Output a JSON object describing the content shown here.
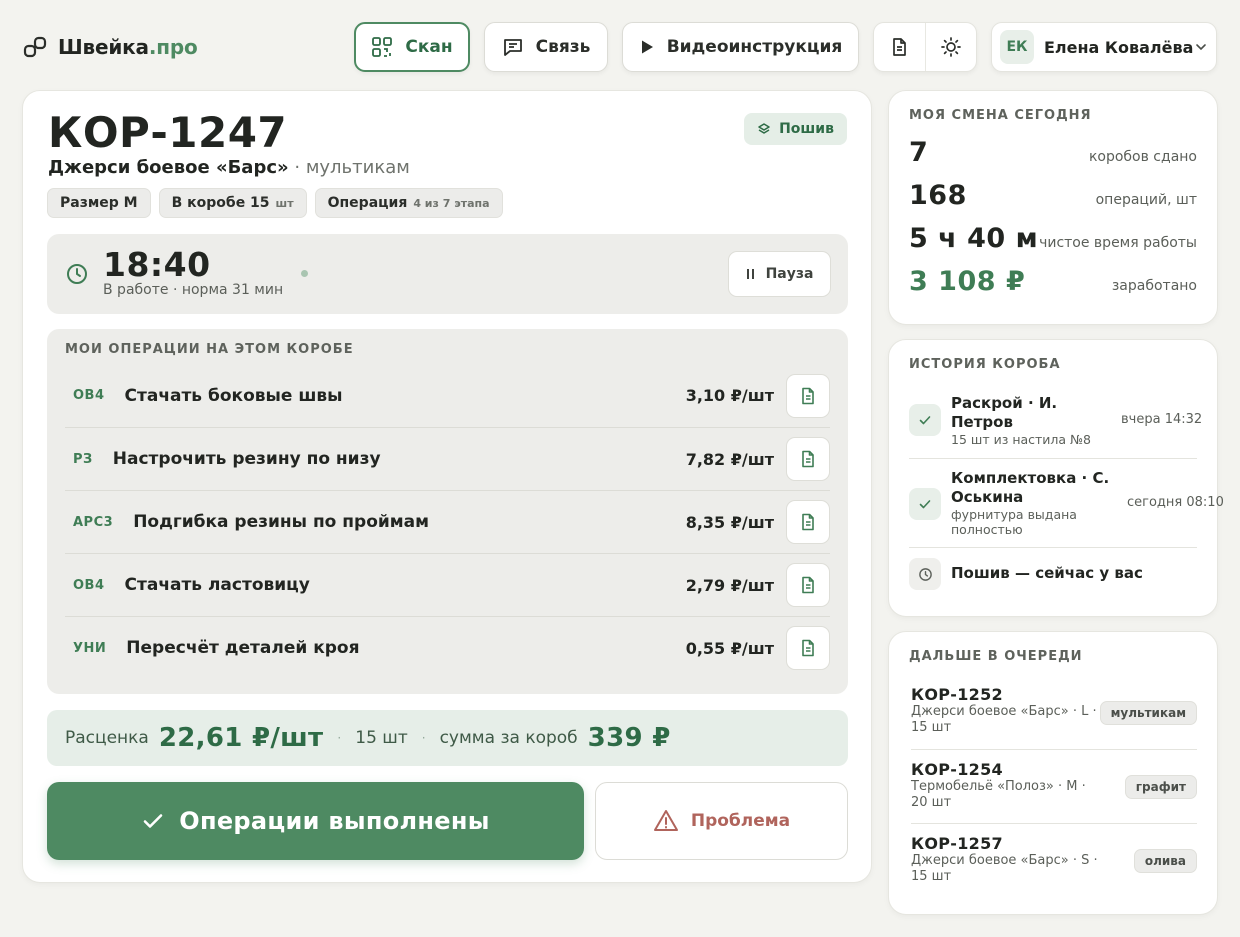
{
  "app": {
    "name_main": "Швейка",
    "name_accent": ".про"
  },
  "header": {
    "scan_label": "Скан",
    "chat_label": "Связь",
    "video_label": "Видеоинструкция",
    "user_initials": "ЕК",
    "user_name": "Елена Ковалёва"
  },
  "box": {
    "id": "КОР-1247",
    "stage": "Пошив",
    "product": "Джерси боевое «Барс»",
    "separator": " · ",
    "color": "мультикам",
    "chips": {
      "size": "Размер М",
      "qty_label": "В коробе 15",
      "qty_unit": "шт",
      "op_label": "Операция",
      "op_progress": "4 из 7 этапа"
    }
  },
  "timer": {
    "time": "18:40",
    "sub": "В работе · норма 31 мин",
    "pause_label": "Пауза"
  },
  "operations": {
    "title": "МОИ ОПЕРАЦИИ НА ЭТОМ КОРОБЕ",
    "items": [
      {
        "code": "ОВ4",
        "name": "Стачать боковые швы",
        "price": "3,10 ₽/шт"
      },
      {
        "code": "РЗ",
        "name": "Настрочить резину по низу",
        "price": "7,82 ₽/шт"
      },
      {
        "code": "АРС3",
        "name": "Подгибка резины по проймам",
        "price": "8,35 ₽/шт"
      },
      {
        "code": "ОВ4",
        "name": "Стачать ластовицу",
        "price": "2,79 ₽/шт"
      },
      {
        "code": "УНИ",
        "name": "Пересчёт деталей кроя",
        "price": "0,55 ₽/шт"
      }
    ]
  },
  "rate": {
    "label": "Расценка",
    "value": "22,61 ₽/шт",
    "qty": "15 шт",
    "sum_label": "сумма за короб",
    "sum_value": "339 ₽"
  },
  "actions": {
    "done_label": "Операции выполнены",
    "problem_label": "Проблема"
  },
  "shift": {
    "title": "МОЯ СМЕНА СЕГОДНЯ",
    "stats": [
      {
        "value": "7",
        "label": "коробов сдано"
      },
      {
        "value": "168",
        "label": "операций, шт"
      },
      {
        "value": "5 ч 40 м",
        "label": "чистое время работы"
      },
      {
        "value": "3 108 ₽",
        "label": "заработано"
      }
    ]
  },
  "history": {
    "title": "ИСТОРИЯ КОРОБА",
    "items": [
      {
        "main": "Раскрой · И. Петров",
        "sub": "15 шт из настила №8",
        "time": "вчера 14:32"
      },
      {
        "main": "Комплектовка · С. Оськина",
        "sub": "фурнитура выдана полностью",
        "time": "сегодня 08:10"
      },
      {
        "main": "Пошив — сейчас у вас"
      }
    ]
  },
  "queue": {
    "title": "ДАЛЬШЕ В ОЧЕРЕДИ",
    "items": [
      {
        "code": "КОР-1252",
        "desc": "Джерси боевое «Барс» · L · 15 шт",
        "tag": "мультикам"
      },
      {
        "code": "КОР-1254",
        "desc": "Термобельё «Полоз» · M · 20 шт",
        "tag": "графит"
      },
      {
        "code": "КОР-1257",
        "desc": "Джерси боевое «Барс» · S · 15 шт",
        "tag": "олива"
      }
    ]
  },
  "colors": {
    "accent": "#4e8a62",
    "danger": "#b0645c",
    "background": "#f3f3ef"
  },
  "icons": [
    "link-icon",
    "qr-icon",
    "chat-icon",
    "play-icon",
    "document-icon",
    "sun-icon",
    "chevron-down-icon",
    "layers-icon",
    "clock-icon",
    "pause-icon",
    "check-icon",
    "warning-icon"
  ]
}
